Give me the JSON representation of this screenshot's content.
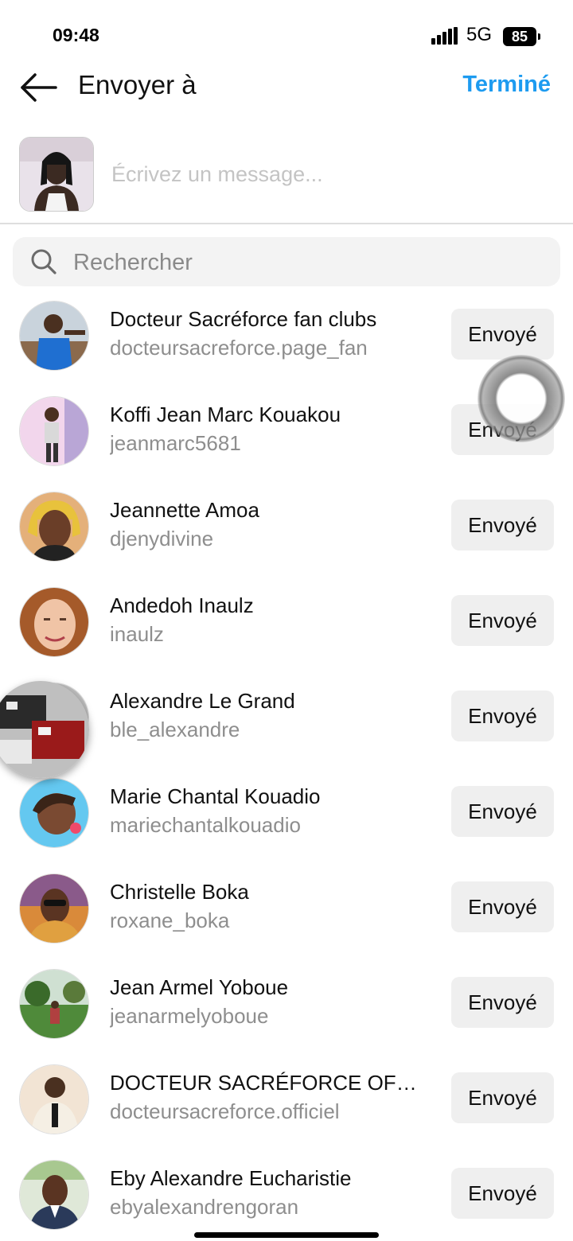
{
  "status_bar": {
    "time": "09:48",
    "network": "5G",
    "battery": "85"
  },
  "header": {
    "title": "Envoyer à",
    "done_label": "Terminé"
  },
  "composer": {
    "placeholder": "Écrivez un message..."
  },
  "search": {
    "placeholder": "Rechercher"
  },
  "contacts": [
    {
      "name": "Docteur Sacréforce fan clubs",
      "username": "docteursacreforce.page_fan",
      "button": "Envoyé"
    },
    {
      "name": "Koffi Jean Marc Kouakou",
      "username": "jeanmarc5681",
      "button": "Envoyé"
    },
    {
      "name": "Jeannette Amoa",
      "username": "djenydivine",
      "button": "Envoyé"
    },
    {
      "name": "Andedoh Inaulz",
      "username": "inaulz",
      "button": "Envoyé"
    },
    {
      "name": "Alexandre Le Grand",
      "username": "ble_alexandre",
      "button": "Envoyé"
    },
    {
      "name": "Marie Chantal Kouadio",
      "username": "mariechantalkouadio",
      "button": "Envoyé"
    },
    {
      "name": "Christelle Boka",
      "username": "roxane_boka",
      "button": "Envoyé"
    },
    {
      "name": "Jean Armel Yoboue",
      "username": "jeanarmelyoboue",
      "button": "Envoyé"
    },
    {
      "name": "DOCTEUR SACRÉFORCE OFFI...",
      "username": "docteursacreforce.officiel",
      "button": "Envoyé"
    },
    {
      "name": "Eby Alexandre Eucharistie",
      "username": "ebyalexandrengoran",
      "button": "Envoyé"
    }
  ],
  "colors": {
    "accent": "#1d9bf0",
    "secondary_text": "#8e8e8e",
    "button_bg": "#efefef"
  }
}
